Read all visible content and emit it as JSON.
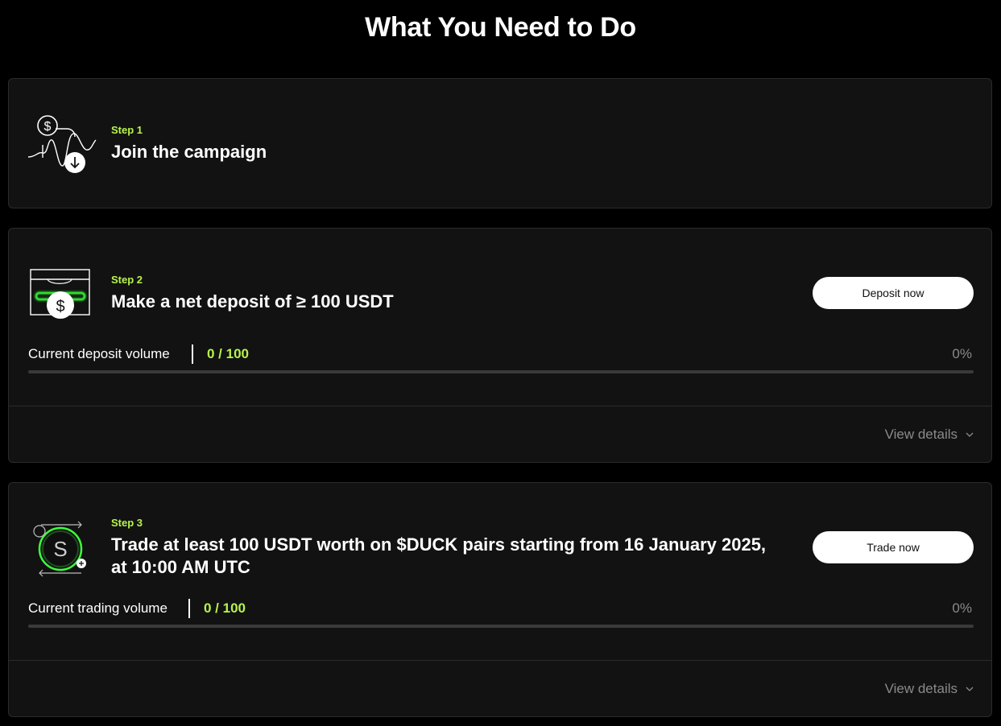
{
  "page": {
    "title": "What You Need to Do"
  },
  "steps": [
    {
      "label": "Step 1",
      "title": "Join the campaign",
      "icon": "join-campaign-icon"
    },
    {
      "label": "Step 2",
      "title": "Make a net deposit of ≥ 100 USDT",
      "icon": "deposit-icon",
      "button_label": "Deposit now",
      "progress_label": "Current deposit volume",
      "progress_value": "0 / 100",
      "progress_percent": "0%",
      "progress_fraction": 0,
      "details_label": "View details"
    },
    {
      "label": "Step 3",
      "title": "Trade at least 100 USDT worth on $DUCK pairs starting from 16 January 2025, at 10:00 AM UTC",
      "icon": "trade-icon",
      "button_label": "Trade now",
      "progress_label": "Current trading volume",
      "progress_value": "0 / 100",
      "progress_percent": "0%",
      "progress_fraction": 0,
      "details_label": "View details"
    }
  ],
  "colors": {
    "accent": "#b7f34c",
    "background": "#000000",
    "card": "#121212",
    "muted_text": "#8a8a8a"
  }
}
